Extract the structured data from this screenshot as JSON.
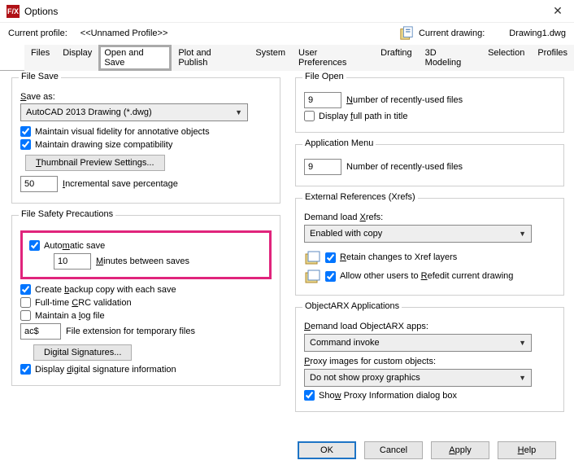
{
  "window": {
    "title": "Options"
  },
  "profile": {
    "label": "Current profile:",
    "value": "<<Unnamed Profile>>",
    "drawing_label": "Current drawing:",
    "drawing_value": "Drawing1.dwg"
  },
  "tabs": {
    "files": "Files",
    "display": "Display",
    "open_save": "Open and Save",
    "plot": "Plot and Publish",
    "system": "System",
    "user_prefs": "User Preferences",
    "drafting": "Drafting",
    "modeling": "3D Modeling",
    "selection": "Selection",
    "profiles": "Profiles"
  },
  "file_save": {
    "legend": "File Save",
    "save_as_label": "Save as:",
    "save_as_value": "AutoCAD 2013 Drawing (*.dwg)",
    "maintain_visual": "Maintain visual fidelity for annotative objects",
    "maintain_size": "Maintain drawing size compatibility",
    "thumb_btn": "Thumbnail Preview Settings...",
    "incr_pct": "50",
    "incr_label": "Incremental save percentage"
  },
  "safety": {
    "legend": "File Safety Precautions",
    "auto_save": "Automatic save",
    "minutes_val": "10",
    "minutes_label": "Minutes between saves",
    "backup": "Create backup copy with each save",
    "crc": "Full-time CRC validation",
    "logfile": "Maintain a log file",
    "ext_val": "ac$",
    "ext_label": "File extension for temporary files",
    "sig_btn": "Digital Signatures...",
    "sig_info": "Display digital signature information"
  },
  "file_open": {
    "legend": "File Open",
    "recent_val": "9",
    "recent_label": "Number of recently-used files",
    "full_path": "Display full path in title"
  },
  "app_menu": {
    "legend": "Application Menu",
    "recent_val": "9",
    "recent_label": "Number of recently-used files"
  },
  "xrefs": {
    "legend": "External References (Xrefs)",
    "demand_label": "Demand load Xrefs:",
    "demand_val": "Enabled with copy",
    "retain": "Retain changes to Xref layers",
    "allow_other": "Allow other users to Refedit current drawing"
  },
  "arx": {
    "legend": "ObjectARX Applications",
    "demand_label": "Demand load ObjectARX apps:",
    "demand_val": "Command invoke",
    "proxy_label": "Proxy images for custom objects:",
    "proxy_val": "Do not show proxy graphics",
    "show_proxy": "Show Proxy Information dialog box"
  },
  "footer": {
    "ok": "OK",
    "cancel": "Cancel",
    "apply": "Apply",
    "help": "Help"
  }
}
